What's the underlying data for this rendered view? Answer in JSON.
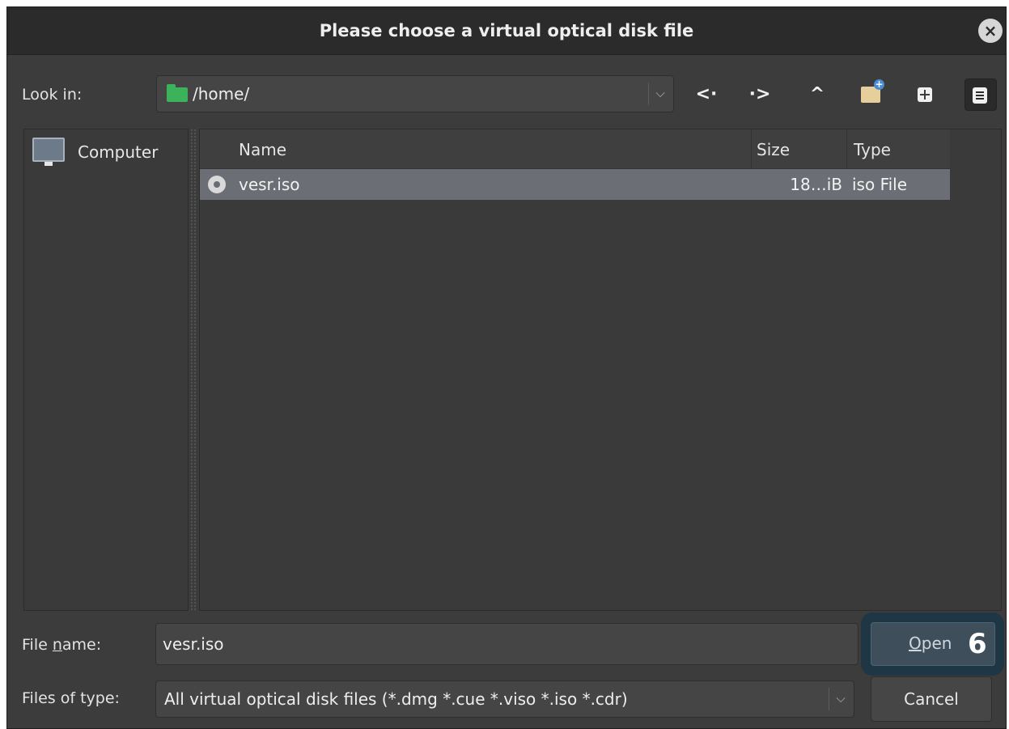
{
  "window": {
    "title": "Please choose a virtual optical disk file",
    "close_icon": "close-icon"
  },
  "toolbar": {
    "look_in_label": "Look in:",
    "path": "/home/",
    "back_glyph": "<·",
    "forward_glyph": "·>",
    "up_glyph": "^"
  },
  "sidebar": {
    "items": [
      {
        "label": "Computer",
        "icon": "monitor-icon"
      }
    ]
  },
  "file_list": {
    "columns": [
      "Name",
      "Size",
      "Type"
    ],
    "rows": [
      {
        "name": "vesr.iso",
        "size": "18…iB",
        "type": "iso File",
        "selected": true
      }
    ]
  },
  "footer": {
    "file_name_label_pre": "File ",
    "file_name_label_mnemonic": "n",
    "file_name_label_post": "ame:",
    "file_name_value": "vesr.iso",
    "files_of_type_label": "Files of type:",
    "files_of_type_value": "All virtual optical disk files (*.dmg *.cue *.viso *.iso *.cdr)",
    "open_mnemonic": "O",
    "open_rest": "pen",
    "step_badge": "6",
    "cancel_label": "Cancel"
  },
  "colors": {
    "dialog_bg": "#3c3c3c",
    "selected_row": "#6b6e75",
    "folder": "#3cb35a",
    "highlight": "#1f3644"
  }
}
